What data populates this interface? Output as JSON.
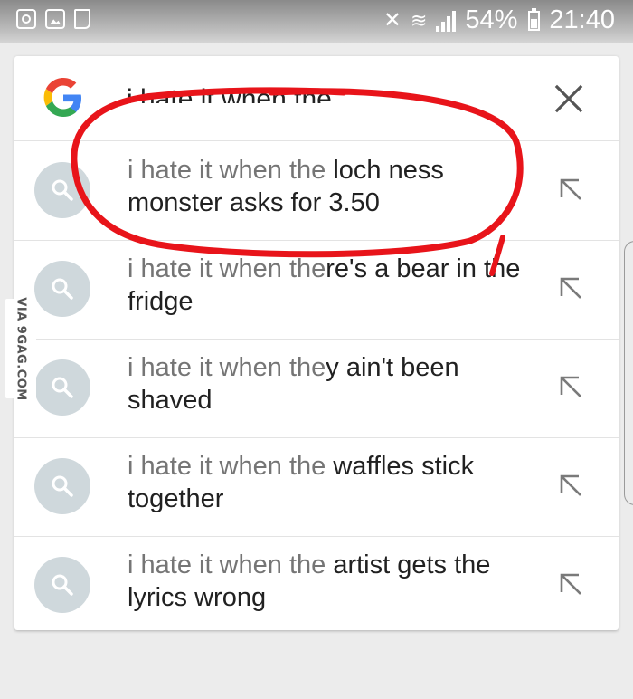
{
  "status_bar": {
    "battery": "54%",
    "time": "21:40"
  },
  "search": {
    "query": "i hate it when the"
  },
  "suggestions": [
    {
      "prefix": "i hate it when the ",
      "completion": "loch ness monster asks for 3.50"
    },
    {
      "prefix": "i hate it when the",
      "completion": "re's a bear in the fridge"
    },
    {
      "prefix": "i hate it when the",
      "completion": "y ain't been shaved"
    },
    {
      "prefix": "i hate it when the ",
      "completion": "waffles stick together"
    },
    {
      "prefix": "i hate it when the ",
      "completion": "artist gets the lyrics wrong"
    }
  ],
  "watermark": "VIA 9GAG.COM",
  "colors": {
    "annotation_red": "#e8141a",
    "search_icon_bg": "#cfd8dc",
    "google_blue": "#4285f4",
    "google_red": "#ea4335",
    "google_yellow": "#fbbc05",
    "google_green": "#34a853"
  },
  "icons": [
    "image-icon",
    "nine-gag-icon",
    "cast-icon",
    "mute-icon",
    "wifi-icon",
    "signal-icon",
    "battery-icon",
    "google-logo-icon",
    "close-icon",
    "search-icon",
    "insert-arrow-icon"
  ]
}
